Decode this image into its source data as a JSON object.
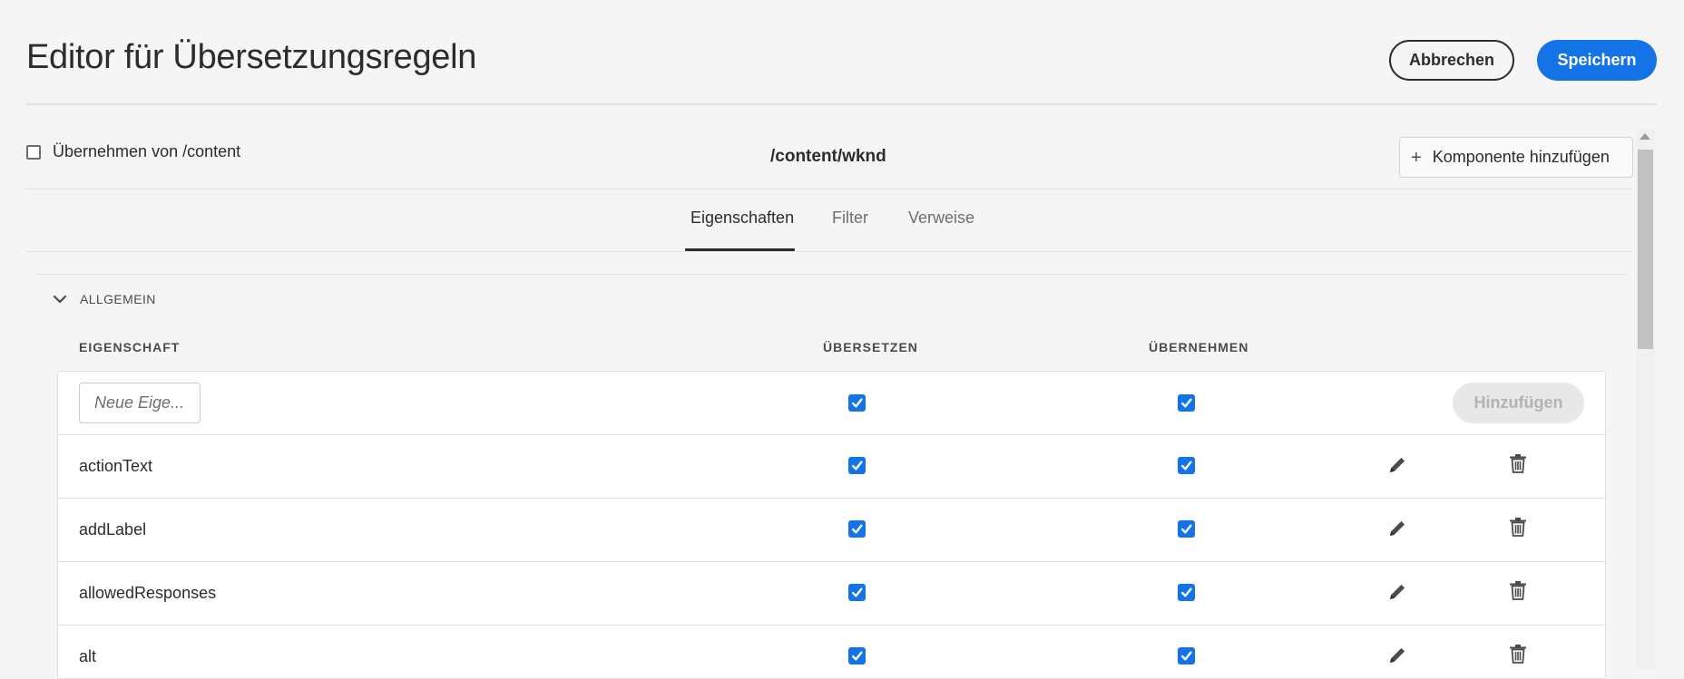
{
  "header": {
    "title": "Editor für Übersetzungsregeln",
    "cancel_label": "Abbrechen",
    "save_label": "Speichern"
  },
  "toolbar": {
    "inherit_label": "Übernehmen von /content",
    "inherit_checked": false,
    "path": "/content/wknd",
    "add_component_label": "Komponente hinzufügen"
  },
  "tabs": [
    {
      "label": "Eigenschaften",
      "active": true
    },
    {
      "label": "Filter",
      "active": false
    },
    {
      "label": "Verweise",
      "active": false
    }
  ],
  "section": {
    "title": "ALLGEMEIN",
    "expanded": true
  },
  "columns": {
    "property": "EIGENSCHAFT",
    "translate": "ÜBERSETZEN",
    "inherit": "ÜBERNEHMEN"
  },
  "new_row": {
    "placeholder": "Neue Eige...",
    "value": "",
    "translate": true,
    "inherit": true,
    "add_label": "Hinzufügen"
  },
  "rows": [
    {
      "property": "actionText",
      "translate": true,
      "inherit": true
    },
    {
      "property": "addLabel",
      "translate": true,
      "inherit": true
    },
    {
      "property": "allowedResponses",
      "translate": true,
      "inherit": true
    },
    {
      "property": "alt",
      "translate": true,
      "inherit": true
    }
  ],
  "colors": {
    "accent": "#1473e6",
    "background": "#f5f5f5"
  },
  "icons": {
    "edit": "pencil-icon",
    "delete": "trash-icon",
    "add": "plus-icon",
    "collapse": "chevron-down-icon"
  }
}
